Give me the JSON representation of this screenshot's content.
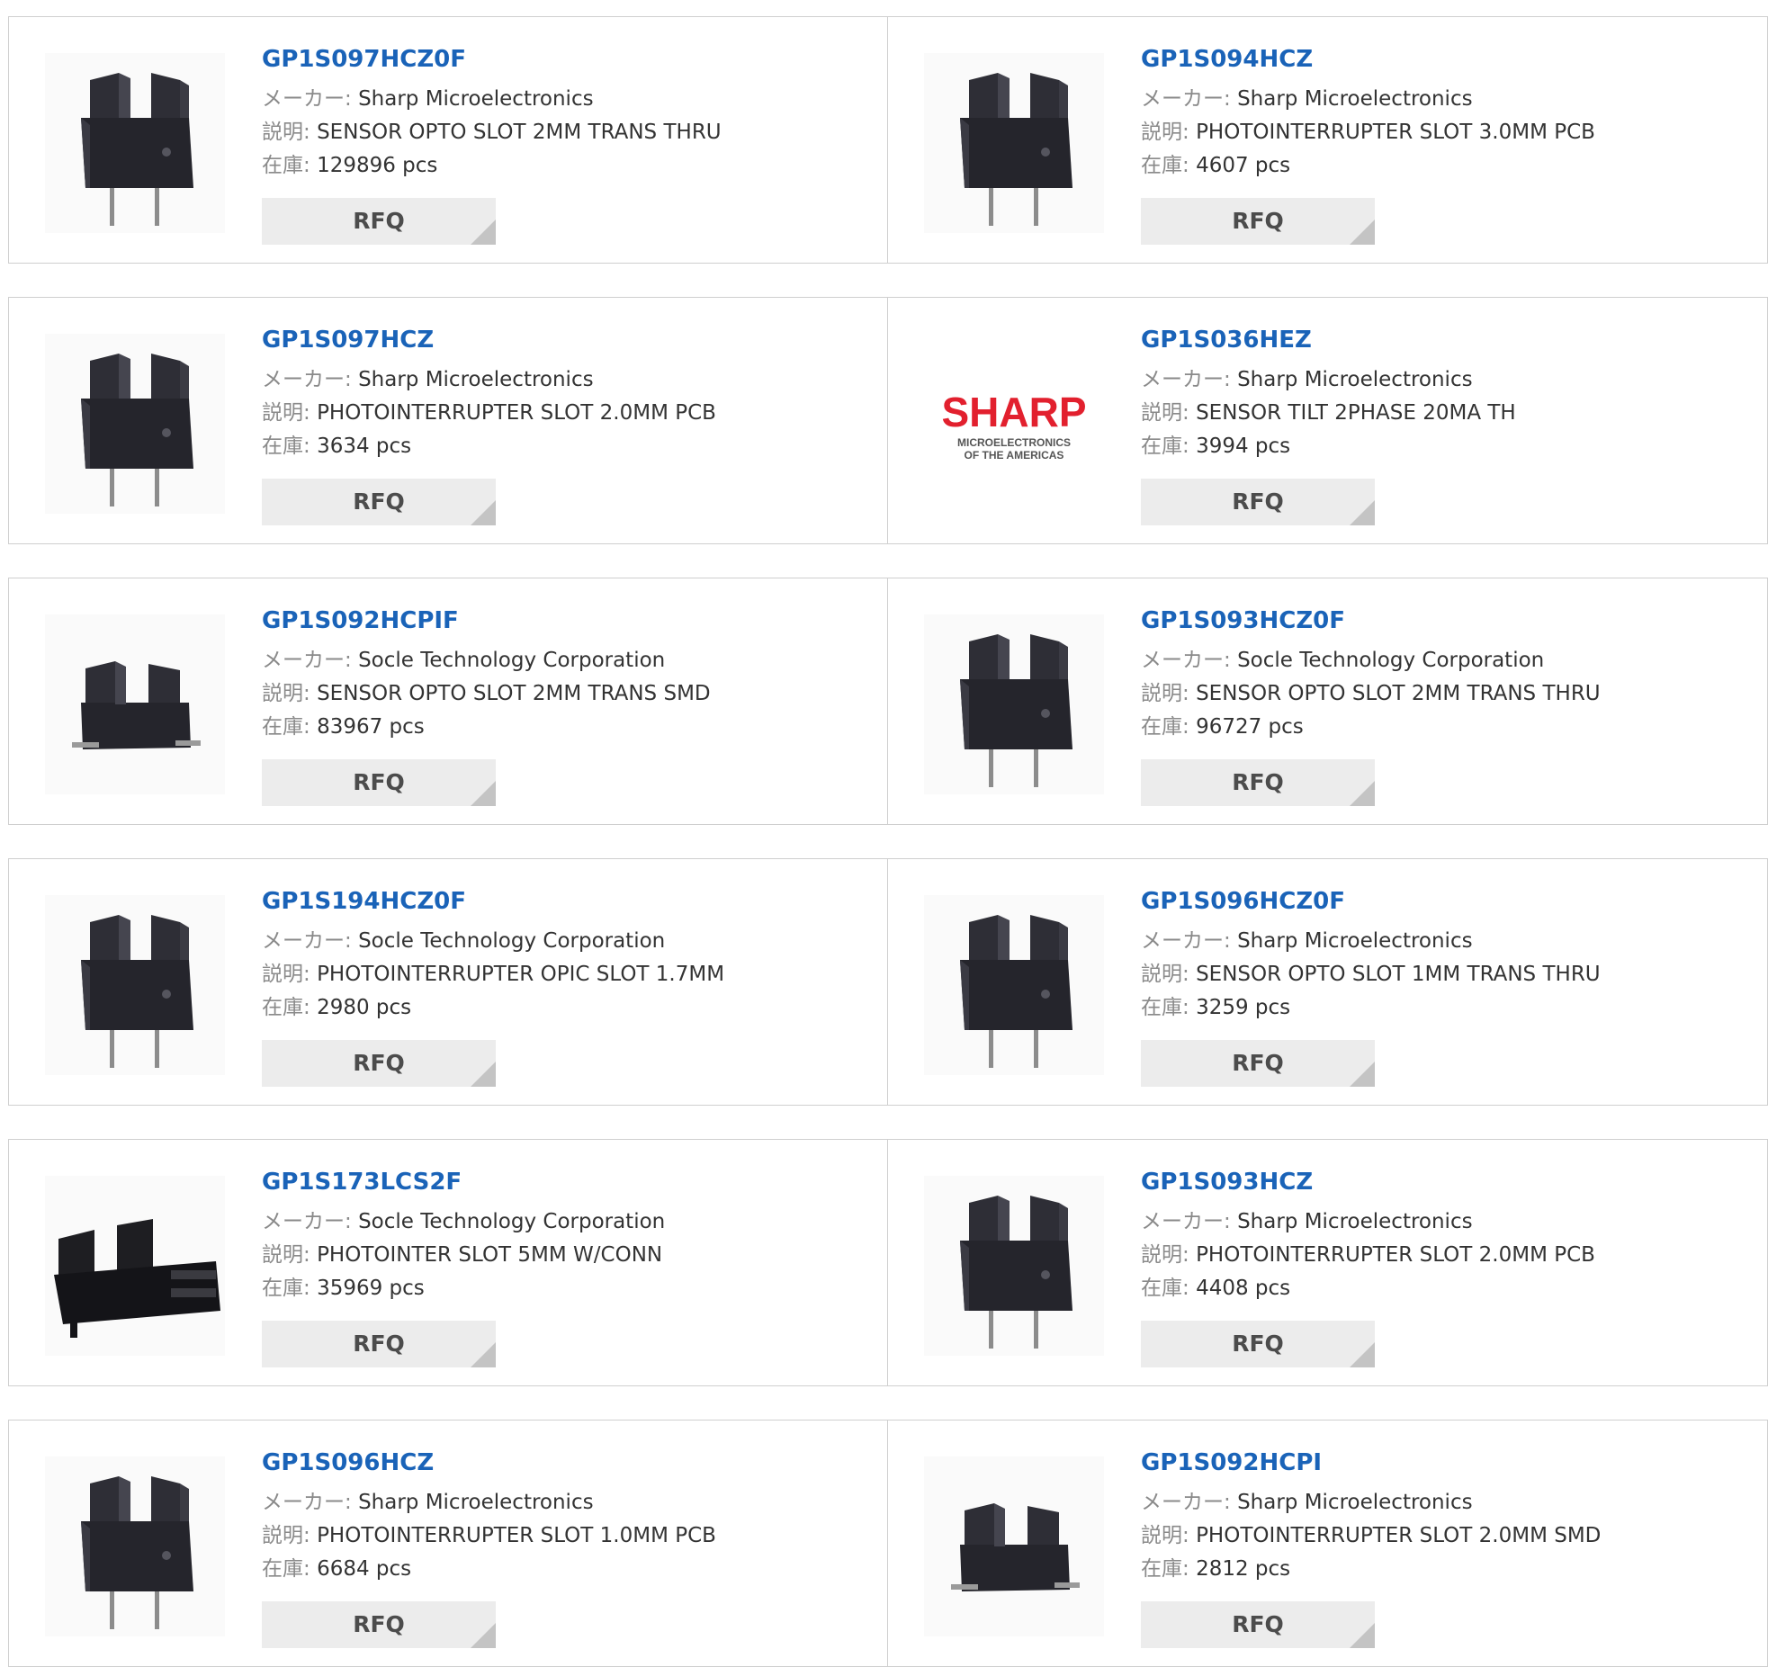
{
  "labels": {
    "maker": "メーカー:",
    "desc": "説明:",
    "stock": "在庫:",
    "rfq": "RFQ"
  },
  "products": [
    {
      "part": "GP1S097HCZ0F",
      "maker": "Sharp Microelectronics",
      "desc": "SENSOR OPTO SLOT 2MM TRANS THRU",
      "stock": "129896 pcs",
      "image": "photointerrupter-thru-hole"
    },
    {
      "part": "GP1S094HCZ",
      "maker": "Sharp Microelectronics",
      "desc": "PHOTOINTERRUPTER SLOT 3.0MM PCB",
      "stock": "4607 pcs",
      "image": "photointerrupter-thru-hole"
    },
    {
      "part": "GP1S097HCZ",
      "maker": "Sharp Microelectronics",
      "desc": "PHOTOINTERRUPTER SLOT 2.0MM PCB",
      "stock": "3634 pcs",
      "image": "photointerrupter-thru-hole"
    },
    {
      "part": "GP1S036HEZ",
      "maker": "Sharp Microelectronics",
      "desc": "SENSOR TILT 2PHASE 20MA TH",
      "stock": "3994 pcs",
      "image": "sharp-logo",
      "logo_text": {
        "brand": "SHARP",
        "line1": "MICROELECTRONICS",
        "line2": "OF THE AMERICAS"
      }
    },
    {
      "part": "GP1S092HCPIF",
      "maker": "Socle Technology Corporation",
      "desc": "SENSOR OPTO SLOT 2MM TRANS SMD",
      "stock": "83967 pcs",
      "image": "photointerrupter-smd"
    },
    {
      "part": "GP1S093HCZ0F",
      "maker": "Socle Technology Corporation",
      "desc": "SENSOR OPTO SLOT 2MM TRANS THRU",
      "stock": "96727 pcs",
      "image": "photointerrupter-thru-hole"
    },
    {
      "part": "GP1S194HCZ0F",
      "maker": "Socle Technology Corporation",
      "desc": "PHOTOINTERRUPTER OPIC SLOT 1.7MM",
      "stock": "2980 pcs",
      "image": "photointerrupter-thru-hole"
    },
    {
      "part": "GP1S096HCZ0F",
      "maker": "Sharp Microelectronics",
      "desc": "SENSOR OPTO SLOT 1MM TRANS THRU",
      "stock": "3259 pcs",
      "image": "photointerrupter-thru-hole"
    },
    {
      "part": "GP1S173LCS2F",
      "maker": "Socle Technology Corporation",
      "desc": "PHOTOINTER SLOT 5MM W/CONN",
      "stock": "35969 pcs",
      "image": "photointerrupter-connector"
    },
    {
      "part": "GP1S093HCZ",
      "maker": "Sharp Microelectronics",
      "desc": "PHOTOINTERRUPTER SLOT 2.0MM PCB",
      "stock": "4408 pcs",
      "image": "photointerrupter-thru-hole"
    },
    {
      "part": "GP1S096HCZ",
      "maker": "Sharp Microelectronics",
      "desc": "PHOTOINTERRUPTER SLOT 1.0MM PCB",
      "stock": "6684 pcs",
      "image": "photointerrupter-thru-hole"
    },
    {
      "part": "GP1S092HCPI",
      "maker": "Sharp Microelectronics",
      "desc": "PHOTOINTERRUPTER SLOT 2.0MM SMD",
      "stock": "2812 pcs",
      "image": "photointerrupter-smd"
    }
  ],
  "colors": {
    "part_link": "#1a63b8",
    "border": "#cfcfcf",
    "rfq_bg": "#ececec",
    "sharp_red": "#e2202e"
  }
}
